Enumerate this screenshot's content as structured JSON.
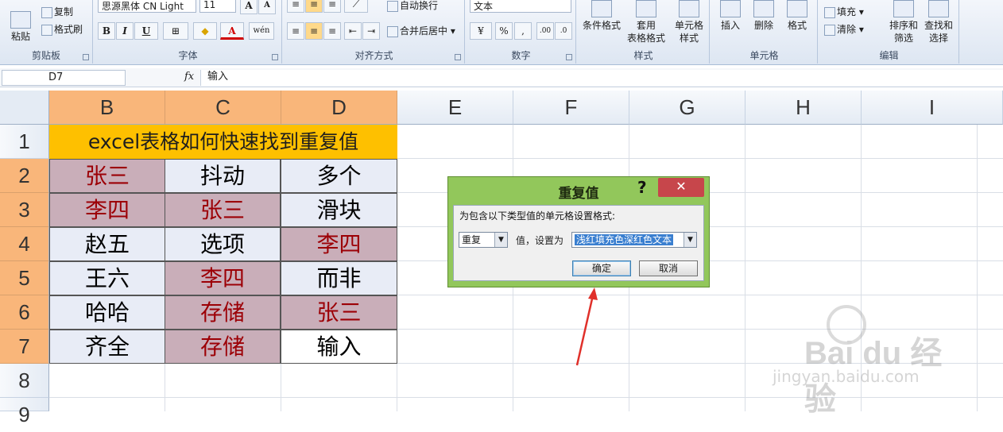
{
  "ribbon": {
    "clipboard": {
      "paste": "粘贴",
      "copy": "复制",
      "format_painter": "格式刷",
      "title": "剪贴板"
    },
    "font": {
      "name": "思源黑体 CN Light",
      "size": "11",
      "bold": "B",
      "italic": "I",
      "underline": "U",
      "grow": "A",
      "shrink": "A",
      "title": "字体"
    },
    "alignment": {
      "wrap": "自动换行",
      "merge": "合并后居中",
      "title": "对齐方式"
    },
    "number": {
      "format": "文本",
      "percent": "%",
      "comma": ",",
      "title": "数字"
    },
    "styles": {
      "conditional": "条件格式",
      "table_format_1": "套用",
      "table_format_2": "表格格式",
      "cell_styles_1": "单元格",
      "cell_styles_2": "样式",
      "title": "样式"
    },
    "cells": {
      "insert": "插入",
      "delete": "删除",
      "format": "格式",
      "title": "单元格"
    },
    "editing": {
      "fill": "填充",
      "clear": "清除",
      "sort_1": "排序和",
      "sort_2": "筛选",
      "find_1": "查找和",
      "find_2": "选择",
      "title": "编辑"
    }
  },
  "formula_bar": {
    "name_box": "D7",
    "fx": "fx",
    "content": "输入"
  },
  "columns": [
    "B",
    "C",
    "D",
    "E",
    "F",
    "G",
    "H",
    "I"
  ],
  "rows": [
    "1",
    "2",
    "3",
    "4",
    "5",
    "6",
    "7",
    "8",
    "9"
  ],
  "sheet": {
    "title": "excel表格如何快速找到重复值",
    "cells": [
      [
        "张三",
        "抖动",
        "多个"
      ],
      [
        "李四",
        "张三",
        "滑块"
      ],
      [
        "赵五",
        "选项",
        "李四"
      ],
      [
        "王六",
        "李四",
        "而非"
      ],
      [
        "哈哈",
        "存储",
        "张三"
      ],
      [
        "齐全",
        "存储",
        "输入"
      ]
    ],
    "duplicate_fill": "#c9aeb9",
    "duplicate_text": "#9c0006"
  },
  "dialog": {
    "title": "重复值",
    "help": "?",
    "close": "✕",
    "label": "为包含以下类型值的单元格设置格式:",
    "type_value": "重复",
    "value_label": "值，设置为",
    "format_value": "浅红填充色深红色文本",
    "ok": "确定",
    "cancel": "取消"
  },
  "watermark": {
    "brand": "Bai du 经验",
    "url": "jingyan.baidu.com"
  }
}
